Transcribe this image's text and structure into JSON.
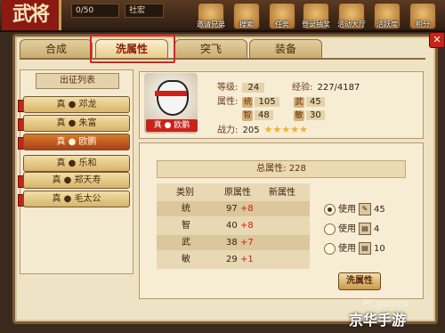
{
  "topbar": {
    "brand": "武将",
    "counter": "0/50",
    "group": "社宏",
    "buttons": [
      "邀请兄弟",
      "搜索",
      "任务",
      "登录抽奖",
      "活动大厅",
      "活跃度",
      "积分"
    ]
  },
  "tabs": [
    "合成",
    "洗属性",
    "突飞",
    "装备"
  ],
  "list": {
    "title": "出征列表",
    "items": [
      "真 ● 邓龙",
      "真 ● 朱富",
      "真 ● 欧鹏",
      "真 ● 乐和",
      "真 ● 郑天寿",
      "真 ● 毛太公"
    ],
    "active_index": 2
  },
  "hero": {
    "name": "真 ● 欧鹏",
    "level_label": "等级:",
    "level": "24",
    "exp_label": "经验:",
    "exp": "227/4187",
    "attr_label": "属性:",
    "tong_badge": "统",
    "tong": "105",
    "wu_badge": "武",
    "wu": "45",
    "zhi_badge": "智",
    "zhi": "48",
    "min_badge": "敏",
    "min": "30",
    "power_label": "战力:",
    "power": "205",
    "stars": "★★★★★"
  },
  "attr": {
    "total_label": "总属性:",
    "total": "228",
    "headers": [
      "类别",
      "原属性",
      "新属性"
    ],
    "rows": [
      {
        "cat": "统",
        "base": "97",
        "delta": "+8"
      },
      {
        "cat": "智",
        "base": "40",
        "delta": "+8"
      },
      {
        "cat": "武",
        "base": "38",
        "delta": "+7"
      },
      {
        "cat": "敏",
        "base": "29",
        "delta": "+1"
      }
    ]
  },
  "use_options": [
    {
      "label": "使用",
      "icon": "scroll-icon",
      "count": "45",
      "selected": true
    },
    {
      "label": "使用",
      "icon": "book-icon",
      "count": "4",
      "selected": false
    },
    {
      "label": "使用",
      "icon": "book-icon",
      "count": "10",
      "selected": false
    }
  ],
  "wash_button": "洗属性",
  "watermark": "京华手游",
  "watermark_small": "PCgames"
}
